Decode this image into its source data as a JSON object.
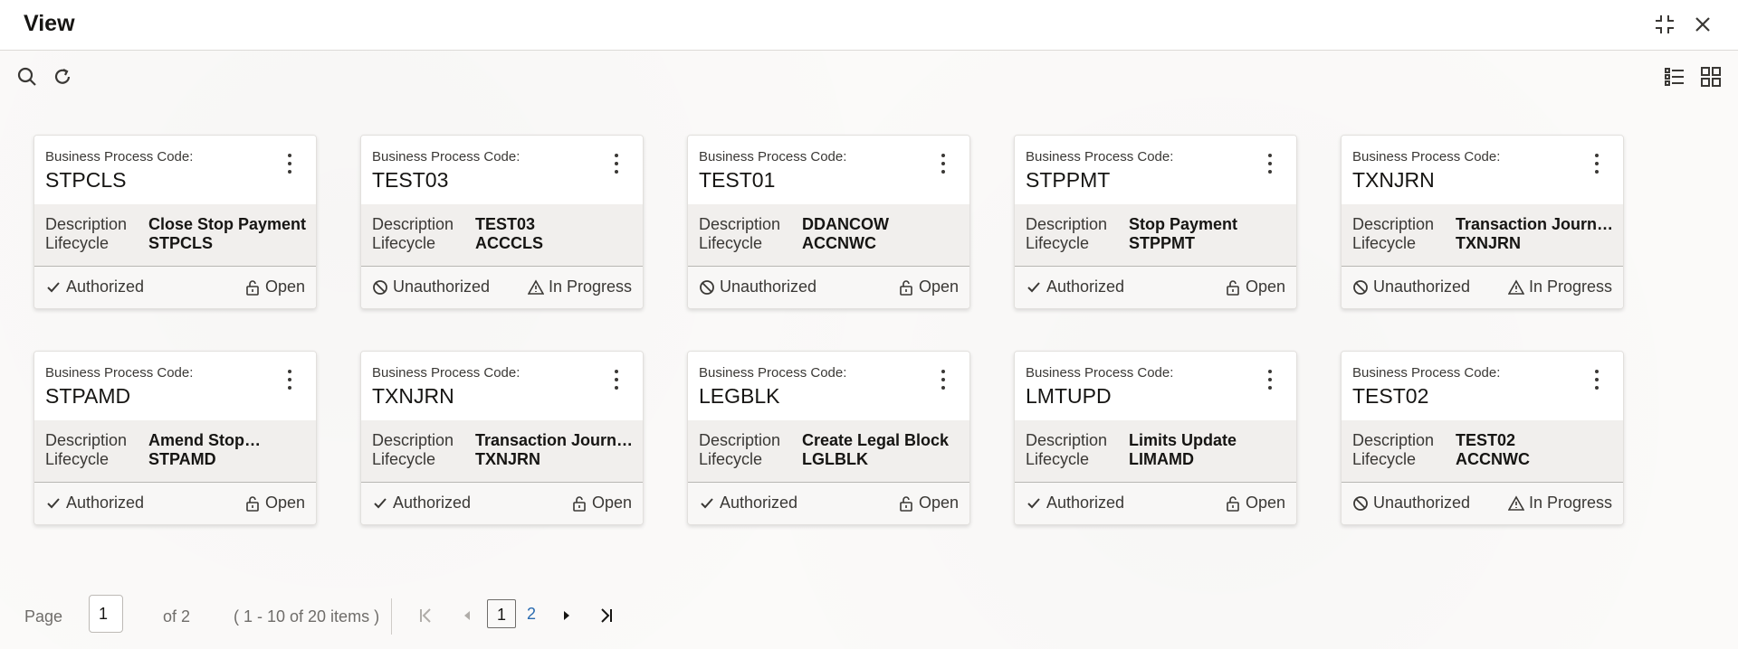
{
  "window": {
    "title": "View"
  },
  "toolbar": {
    "search_icon": "search-icon",
    "refresh_icon": "refresh-icon"
  },
  "cards": [
    {
      "label": "Business Process Code:",
      "code": "STPCLS",
      "desc_key": "Description",
      "desc": "Close Stop Payment",
      "life_key": "Lifecycle",
      "life": "STPCLS",
      "status": "Authorized",
      "status_icon": "check-icon",
      "state": "Open",
      "state_icon": "unlock-icon"
    },
    {
      "label": "Business Process Code:",
      "code": "TEST03",
      "desc_key": "Description",
      "desc": "TEST03",
      "life_key": "Lifecycle",
      "life": "ACCCLS",
      "status": "Unauthorized",
      "status_icon": "ban-icon",
      "state": "In Progress",
      "state_icon": "warning-icon"
    },
    {
      "label": "Business Process Code:",
      "code": "TEST01",
      "desc_key": "Description",
      "desc": "DDANCOW",
      "life_key": "Lifecycle",
      "life": "ACCNWC",
      "status": "Unauthorized",
      "status_icon": "ban-icon",
      "state": "Open",
      "state_icon": "unlock-icon"
    },
    {
      "label": "Business Process Code:",
      "code": "STPPMT",
      "desc_key": "Description",
      "desc": "Stop Payment",
      "life_key": "Lifecycle",
      "life": "STPPMT",
      "status": "Authorized",
      "status_icon": "check-icon",
      "state": "Open",
      "state_icon": "unlock-icon"
    },
    {
      "label": "Business Process Code:",
      "code": "TXNJRN",
      "desc_key": "Description",
      "desc": "Transaction Journ…",
      "life_key": "Lifecycle",
      "life": "TXNJRN",
      "status": "Unauthorized",
      "status_icon": "ban-icon",
      "state": "In Progress",
      "state_icon": "warning-icon"
    },
    {
      "label": "Business Process Code:",
      "code": "STPAMD",
      "desc_key": "Description",
      "desc": "Amend Stop…",
      "life_key": "Lifecycle",
      "life": "STPAMD",
      "status": "Authorized",
      "status_icon": "check-icon",
      "state": "Open",
      "state_icon": "unlock-icon"
    },
    {
      "label": "Business Process Code:",
      "code": "TXNJRN",
      "desc_key": "Description",
      "desc": "Transaction Journ…",
      "life_key": "Lifecycle",
      "life": "TXNJRN",
      "status": "Authorized",
      "status_icon": "check-icon",
      "state": "Open",
      "state_icon": "unlock-icon"
    },
    {
      "label": "Business Process Code:",
      "code": "LEGBLK",
      "desc_key": "Description",
      "desc": "Create Legal Block",
      "life_key": "Lifecycle",
      "life": "LGLBLK",
      "status": "Authorized",
      "status_icon": "check-icon",
      "state": "Open",
      "state_icon": "unlock-icon"
    },
    {
      "label": "Business Process Code:",
      "code": "LMTUPD",
      "desc_key": "Description",
      "desc": "Limits Update",
      "life_key": "Lifecycle",
      "life": "LIMAMD",
      "status": "Authorized",
      "status_icon": "check-icon",
      "state": "Open",
      "state_icon": "unlock-icon"
    },
    {
      "label": "Business Process Code:",
      "code": "TEST02",
      "desc_key": "Description",
      "desc": "TEST02",
      "life_key": "Lifecycle",
      "life": "ACCNWC",
      "status": "Unauthorized",
      "status_icon": "ban-icon",
      "state": "In Progress",
      "state_icon": "warning-icon"
    }
  ],
  "pager": {
    "page_label": "Page",
    "page_value": "1",
    "of_label": "of 2",
    "items_label": "( 1 - 10 of 20 items )",
    "pages": [
      "1",
      "2"
    ],
    "current": "1"
  },
  "colors": {
    "link": "#2a6bb0",
    "text": "#161513",
    "muted": "#6f6d6a"
  }
}
